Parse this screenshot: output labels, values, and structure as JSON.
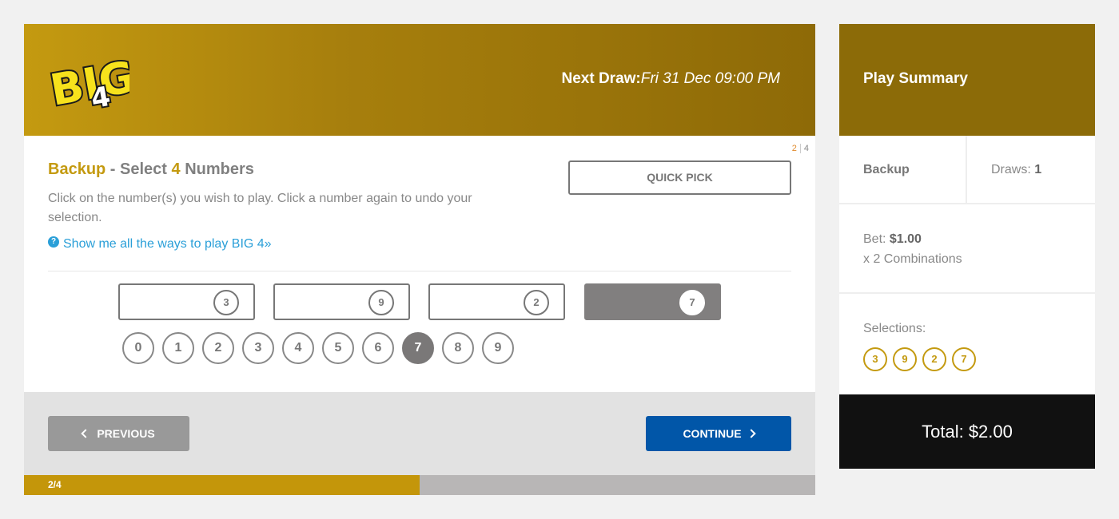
{
  "header": {
    "logo_text": "BIG 4",
    "next_draw_label": "Next Draw:",
    "next_draw_value": "Fri 31 Dec 09:00 PM"
  },
  "step": {
    "current": "2",
    "total": "4"
  },
  "selection": {
    "title_game": "Backup",
    "title_dash": " - Select ",
    "title_count": "4",
    "title_tail": " Numbers",
    "description": "Click on the number(s) you wish to play. Click a number again to undo your selection.",
    "help_icon": "?",
    "help_link": "Show me all the ways to play BIG 4»",
    "quick_pick": "QUICK PICK",
    "slots": [
      {
        "value": "3",
        "active": false
      },
      {
        "value": "9",
        "active": false
      },
      {
        "value": "2",
        "active": false
      },
      {
        "value": "7",
        "active": true
      }
    ],
    "number_pad": [
      "0",
      "1",
      "2",
      "3",
      "4",
      "5",
      "6",
      "7",
      "8",
      "9"
    ],
    "pad_selected": "7"
  },
  "footer": {
    "previous": "PREVIOUS",
    "continue": "CONTINUE",
    "progress_label": "2/4",
    "progress_fraction": 0.5
  },
  "summary": {
    "title": "Play Summary",
    "game": "Backup",
    "draws_label": "Draws: ",
    "draws_value": "1",
    "bet_label": "Bet: ",
    "bet_value": "$1.00",
    "combinations": "x 2 Combinations",
    "selections_label": "Selections:",
    "selections": [
      "3",
      "9",
      "2",
      "7"
    ],
    "total": "Total: $2.00"
  },
  "colors": {
    "gold": "#c49a10",
    "continue_blue": "#0156a8",
    "link_blue": "#2a9fd8",
    "total_bg": "#111111"
  }
}
